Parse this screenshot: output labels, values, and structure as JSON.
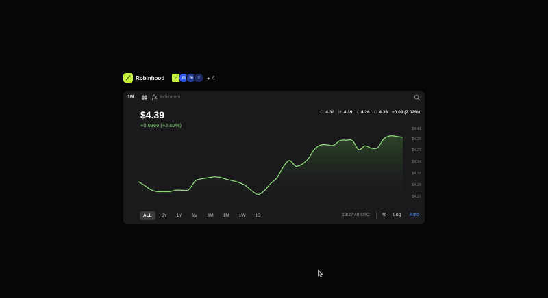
{
  "header": {
    "logo_letter": "⟋",
    "app_name": "Robinhood",
    "avatars": [
      "⟋",
      "m",
      "m",
      "≡"
    ],
    "plus_count": "+ 4"
  },
  "toolbar": {
    "interval": "1M",
    "candle_icon": "candlestick-icon",
    "fx_label": "fx",
    "indicators": "Indicators",
    "search_icon": "search-icon"
  },
  "price": {
    "value": "$4.39",
    "change": "+0.0869 (+2.02%)"
  },
  "ohlc": {
    "o_label": "O",
    "o": "4.30",
    "h_label": "H",
    "h": "4.39",
    "l_label": "L",
    "l": "4.26",
    "c_label": "C",
    "c": "4.39",
    "change": "+0.09 (2.02%)"
  },
  "ranges": [
    "ALL",
    "5Y",
    "1Y",
    "6M",
    "3M",
    "1M",
    "1W",
    "1D"
  ],
  "active_range": "ALL",
  "controls": {
    "time": "13:27:40 UTC",
    "percent": "%",
    "log": "Log",
    "auto": "Auto"
  },
  "colors": {
    "line": "#8fdc7a",
    "accent": "#c7f23a",
    "auto": "#4b8df8"
  },
  "chart_data": {
    "type": "area",
    "y_ticks": [
      "$4.41",
      "$4.39",
      "$4.37",
      "$4.34",
      "$4.32",
      "$4.29",
      "$4.27"
    ],
    "ylim": [
      4.26,
      4.415
    ],
    "values": [
      4.295,
      4.287,
      4.278,
      4.274,
      4.274,
      4.274,
      4.277,
      4.277,
      4.278,
      4.296,
      4.301,
      4.303,
      4.305,
      4.304,
      4.3,
      4.297,
      4.293,
      4.287,
      4.276,
      4.268,
      4.276,
      4.291,
      4.303,
      4.326,
      4.34,
      4.328,
      4.332,
      4.344,
      4.364,
      4.373,
      4.373,
      4.372,
      4.382,
      4.383,
      4.382,
      4.363,
      4.371,
      4.366,
      4.367,
      4.386,
      4.392,
      4.391,
      4.389
    ]
  }
}
